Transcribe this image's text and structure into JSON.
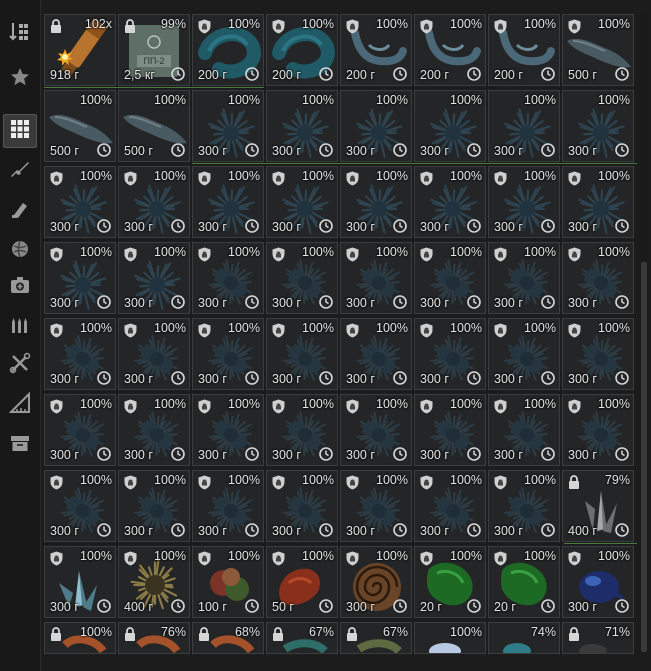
{
  "sidebar": {
    "items": [
      {
        "icon": "sort-icon"
      },
      {
        "icon": "favorites-star-icon"
      },
      {
        "icon": "all-items-grid-icon",
        "active": true
      },
      {
        "icon": "weapons-rifle-icon"
      },
      {
        "icon": "gear-parts-icon"
      },
      {
        "icon": "barter-ball-icon"
      },
      {
        "icon": "medical-kit-icon"
      },
      {
        "icon": "ammo-icon"
      },
      {
        "icon": "tools-icon"
      },
      {
        "icon": "maps-ruler-icon"
      },
      {
        "icon": "containers-box-icon"
      }
    ]
  },
  "grid": {
    "rows": [
      [
        {
          "pct": "102x",
          "weight": "918 г",
          "badge": "lock",
          "art": "ammo",
          "clock": false,
          "expl": true
        },
        {
          "pct": "99%",
          "weight": "2,5 кг",
          "badge": "lock",
          "art": "box",
          "clock": true
        },
        {
          "pct": "100%",
          "weight": "200 г",
          "badge": "shield",
          "art": "ring-teal",
          "clock": true
        },
        {
          "pct": "100%",
          "weight": "200 г",
          "badge": "shield",
          "art": "ring-teal",
          "clock": true
        },
        {
          "pct": "100%",
          "weight": "200 г",
          "badge": "shield",
          "art": "hook",
          "clock": true
        },
        {
          "pct": "100%",
          "weight": "200 г",
          "badge": "shield",
          "art": "hook",
          "clock": true
        },
        {
          "pct": "100%",
          "weight": "200 г",
          "badge": "shield",
          "art": "hook",
          "clock": true
        },
        {
          "pct": "100%",
          "weight": "500 г",
          "badge": "shield",
          "art": "blob",
          "clock": true
        }
      ],
      [
        {
          "pct": "100%",
          "weight": "500 г",
          "badge": "none",
          "art": "blob",
          "clock": true
        },
        {
          "pct": "100%",
          "weight": "500 г",
          "badge": "none",
          "art": "blob",
          "clock": true
        },
        {
          "pct": "100%",
          "weight": "300 г",
          "badge": "none",
          "art": "spiky",
          "clock": true
        },
        {
          "pct": "100%",
          "weight": "300 г",
          "badge": "none",
          "art": "spiky",
          "clock": true
        },
        {
          "pct": "100%",
          "weight": "300 г",
          "badge": "none",
          "art": "spiky",
          "clock": true
        },
        {
          "pct": "100%",
          "weight": "300 г",
          "badge": "none",
          "art": "spiky",
          "clock": true
        },
        {
          "pct": "100%",
          "weight": "300 г",
          "badge": "none",
          "art": "spiky",
          "clock": true
        },
        {
          "pct": "100%",
          "weight": "300 г",
          "badge": "none",
          "art": "spiky",
          "clock": true
        }
      ],
      [
        {
          "pct": "100%",
          "weight": "300 г",
          "badge": "shield",
          "art": "spiky",
          "clock": true
        },
        {
          "pct": "100%",
          "weight": "300 г",
          "badge": "shield",
          "art": "spiky",
          "clock": true
        },
        {
          "pct": "100%",
          "weight": "300 г",
          "badge": "shield",
          "art": "spiky",
          "clock": true
        },
        {
          "pct": "100%",
          "weight": "300 г",
          "badge": "shield",
          "art": "spiky",
          "clock": true
        },
        {
          "pct": "100%",
          "weight": "300 г",
          "badge": "shield",
          "art": "spiky",
          "clock": true
        },
        {
          "pct": "100%",
          "weight": "300 г",
          "badge": "shield",
          "art": "spiky",
          "clock": true
        },
        {
          "pct": "100%",
          "weight": "300 г",
          "badge": "shield",
          "art": "spiky",
          "clock": true
        },
        {
          "pct": "100%",
          "weight": "300 г",
          "badge": "shield",
          "art": "spiky",
          "clock": true
        }
      ],
      [
        {
          "pct": "100%",
          "weight": "300 г",
          "badge": "shield",
          "art": "spiky",
          "clock": true
        },
        {
          "pct": "100%",
          "weight": "300 г",
          "badge": "shield",
          "art": "spiky",
          "clock": true
        },
        {
          "pct": "100%",
          "weight": "300 г",
          "badge": "shield",
          "art": "cluster",
          "clock": true
        },
        {
          "pct": "100%",
          "weight": "300 г",
          "badge": "shield",
          "art": "cluster",
          "clock": true
        },
        {
          "pct": "100%",
          "weight": "300 г",
          "badge": "shield",
          "art": "cluster",
          "clock": true
        },
        {
          "pct": "100%",
          "weight": "300 г",
          "badge": "shield",
          "art": "cluster",
          "clock": true
        },
        {
          "pct": "100%",
          "weight": "300 г",
          "badge": "shield",
          "art": "cluster",
          "clock": true
        },
        {
          "pct": "100%",
          "weight": "300 г",
          "badge": "shield",
          "art": "cluster",
          "clock": true
        }
      ],
      [
        {
          "pct": "100%",
          "weight": "300 г",
          "badge": "shield",
          "art": "cluster",
          "clock": true
        },
        {
          "pct": "100%",
          "weight": "300 г",
          "badge": "shield",
          "art": "cluster",
          "clock": true
        },
        {
          "pct": "100%",
          "weight": "300 г",
          "badge": "shield",
          "art": "cluster",
          "clock": true
        },
        {
          "pct": "100%",
          "weight": "300 г",
          "badge": "shield",
          "art": "cluster",
          "clock": true
        },
        {
          "pct": "100%",
          "weight": "300 г",
          "badge": "shield",
          "art": "cluster",
          "clock": true
        },
        {
          "pct": "100%",
          "weight": "300 г",
          "badge": "shield",
          "art": "cluster",
          "clock": true
        },
        {
          "pct": "100%",
          "weight": "300 г",
          "badge": "shield",
          "art": "cluster",
          "clock": true
        },
        {
          "pct": "100%",
          "weight": "300 г",
          "badge": "shield",
          "art": "cluster",
          "clock": true
        }
      ],
      [
        {
          "pct": "100%",
          "weight": "300 г",
          "badge": "shield",
          "art": "cluster",
          "clock": true
        },
        {
          "pct": "100%",
          "weight": "300 г",
          "badge": "shield",
          "art": "cluster",
          "clock": true
        },
        {
          "pct": "100%",
          "weight": "300 г",
          "badge": "shield",
          "art": "cluster",
          "clock": true
        },
        {
          "pct": "100%",
          "weight": "300 г",
          "badge": "shield",
          "art": "cluster",
          "clock": true
        },
        {
          "pct": "100%",
          "weight": "300 г",
          "badge": "shield",
          "art": "cluster",
          "clock": true
        },
        {
          "pct": "100%",
          "weight": "300 г",
          "badge": "shield",
          "art": "cluster",
          "clock": true
        },
        {
          "pct": "100%",
          "weight": "300 г",
          "badge": "shield",
          "art": "cluster",
          "clock": true
        },
        {
          "pct": "100%",
          "weight": "300 г",
          "badge": "shield",
          "art": "cluster",
          "clock": true
        }
      ],
      [
        {
          "pct": "100%",
          "weight": "300 г",
          "badge": "shield",
          "art": "cluster",
          "clock": true
        },
        {
          "pct": "100%",
          "weight": "300 г",
          "badge": "shield",
          "art": "cluster",
          "clock": true
        },
        {
          "pct": "100%",
          "weight": "300 г",
          "badge": "shield",
          "art": "cluster",
          "clock": true
        },
        {
          "pct": "100%",
          "weight": "300 г",
          "badge": "shield",
          "art": "cluster",
          "clock": true
        },
        {
          "pct": "100%",
          "weight": "300 г",
          "badge": "shield",
          "art": "cluster",
          "clock": true
        },
        {
          "pct": "100%",
          "weight": "300 г",
          "badge": "shield",
          "art": "cluster",
          "clock": true
        },
        {
          "pct": "100%",
          "weight": "300 г",
          "badge": "shield",
          "art": "cluster",
          "clock": true
        },
        {
          "pct": "79%",
          "weight": "400 г",
          "badge": "lock",
          "art": "crystal-dark",
          "clock": true
        }
      ],
      [
        {
          "pct": "100%",
          "weight": "300 г",
          "badge": "shield",
          "art": "crystal-blue",
          "clock": true
        },
        {
          "pct": "100%",
          "weight": "400 г",
          "badge": "shield",
          "art": "urchin",
          "clock": true
        },
        {
          "pct": "100%",
          "weight": "100 г",
          "badge": "shield",
          "art": "flower",
          "clock": true
        },
        {
          "pct": "100%",
          "weight": "50 г",
          "badge": "shield",
          "art": "red-blob",
          "clock": true
        },
        {
          "pct": "100%",
          "weight": "300 г",
          "badge": "shield",
          "art": "spiral",
          "clock": true
        },
        {
          "pct": "100%",
          "weight": "20 г",
          "badge": "shield",
          "art": "green",
          "clock": true
        },
        {
          "pct": "100%",
          "weight": "20 г",
          "badge": "shield",
          "art": "green",
          "clock": true
        },
        {
          "pct": "100%",
          "weight": "300 г",
          "badge": "shield",
          "art": "blue-bug",
          "clock": true
        }
      ],
      [
        {
          "pct": "100%",
          "badge": "lock",
          "art": "partial-orange"
        },
        {
          "pct": "76%",
          "badge": "lock",
          "art": "partial-orange"
        },
        {
          "pct": "68%",
          "badge": "lock",
          "art": "partial-orange"
        },
        {
          "pct": "67%",
          "badge": "lock",
          "art": "partial-teal"
        },
        {
          "pct": "67%",
          "badge": "lock",
          "art": "partial-green"
        },
        {
          "pct": "100%",
          "badge": "none",
          "art": "partial-white"
        },
        {
          "pct": "74%",
          "badge": "none",
          "art": "partial-cyan"
        },
        {
          "pct": "71%",
          "badge": "lock",
          "art": "partial-dark"
        }
      ]
    ]
  }
}
